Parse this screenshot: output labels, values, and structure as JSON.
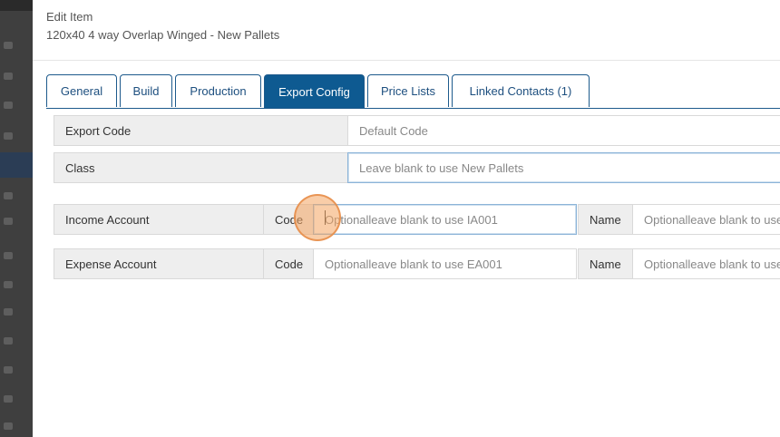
{
  "modal": {
    "title": "Edit Item",
    "subtitle": "120x40 4 way Overlap Winged - New Pallets"
  },
  "tabs": [
    {
      "label": "General",
      "active": false
    },
    {
      "label": "Build",
      "active": false
    },
    {
      "label": "Production",
      "active": false
    },
    {
      "label": "Export Config",
      "active": true
    },
    {
      "label": "Price Lists",
      "active": false
    },
    {
      "label": "Linked Contacts (1)",
      "active": false
    }
  ],
  "export_code": {
    "label": "Export Code",
    "placeholder": "Default Code"
  },
  "class": {
    "label": "Class",
    "placeholder": "Leave blank to use New Pallets"
  },
  "income_account": {
    "label": "Income Account",
    "code_label": "Code",
    "code_placeholder": "Optionalleave blank to use IA001",
    "name_label": "Name",
    "name_placeholder": "Optionalleave blank to use"
  },
  "expense_account": {
    "label": "Expense Account",
    "code_label": "Code",
    "code_placeholder": "Optionalleave blank to use EA001",
    "name_label": "Name",
    "name_placeholder": "Optionalleave blank to use"
  },
  "colors": {
    "tab_active_bg": "#0e5a91",
    "tab_border": "#1d5a8c",
    "label_bg": "#eeeeee",
    "cursor_highlight": "#f4a460"
  }
}
